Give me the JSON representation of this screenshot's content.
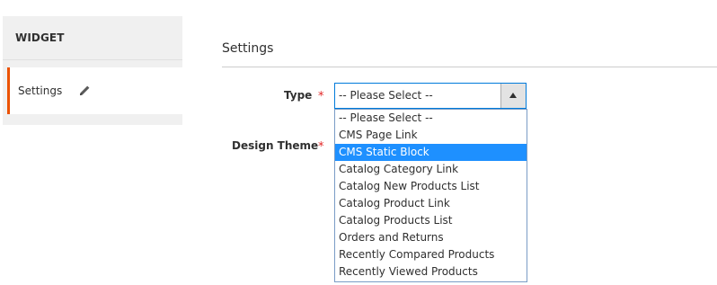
{
  "sidebar": {
    "title": "WIDGET",
    "items": [
      {
        "label": "Settings"
      }
    ]
  },
  "main": {
    "section_title": "Settings",
    "fields": {
      "type": {
        "label": "Type",
        "required_mark": "*",
        "selected_value": "-- Please Select --"
      },
      "design_theme": {
        "label": "Design Theme",
        "required_mark": "*"
      }
    },
    "dropdown": {
      "highlighted_index": 2,
      "options": [
        "-- Please Select --",
        "CMS Page Link",
        "CMS Static Block",
        "Catalog Category Link",
        "Catalog New Products List",
        "Catalog Product Link",
        "Catalog Products List",
        "Orders and Returns",
        "Recently Compared Products",
        "Recently Viewed Products"
      ]
    }
  },
  "colors": {
    "accent": "#eb5202",
    "required": "#e22626",
    "focus_border": "#007bdb",
    "highlight": "#1e90ff"
  },
  "icons": {
    "edit": "pencil-icon",
    "select_arrow": "arrow-up-icon"
  }
}
